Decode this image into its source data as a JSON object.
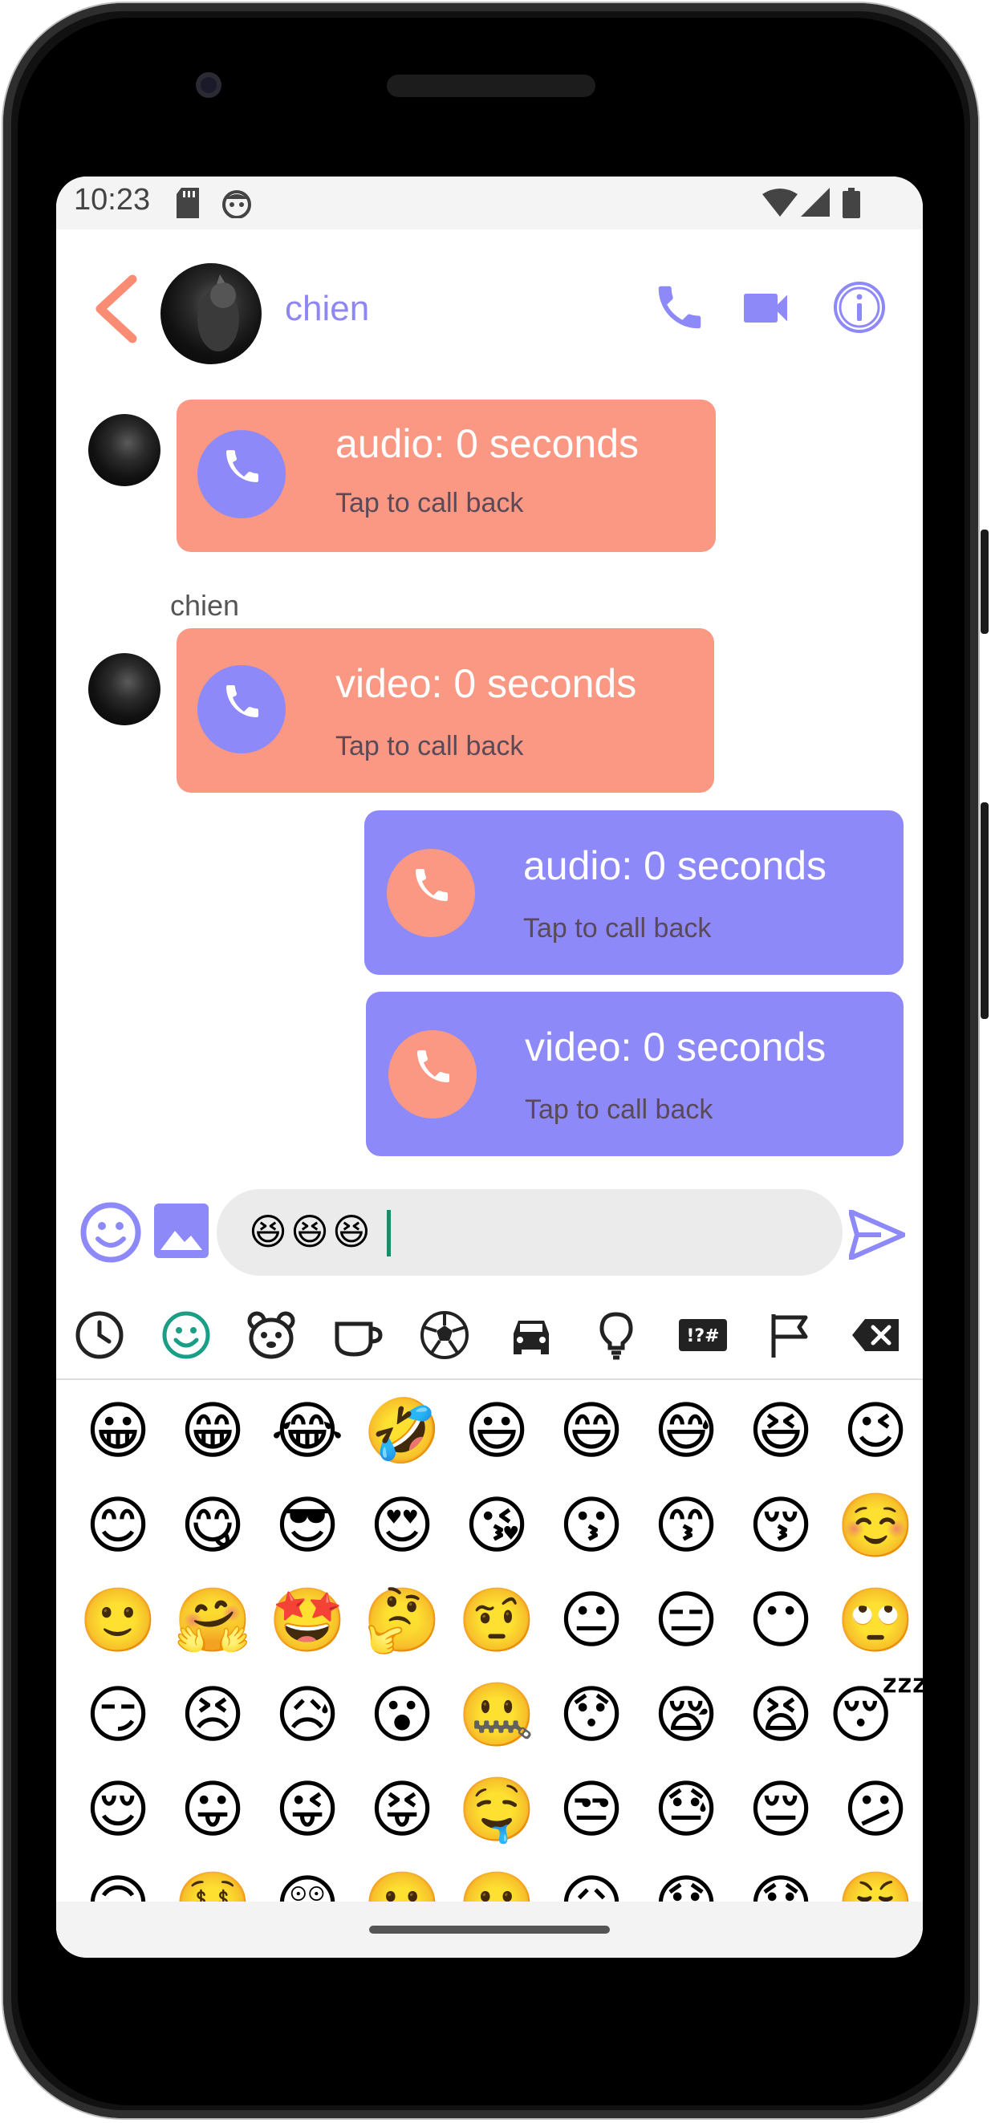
{
  "status_bar": {
    "time": "10:23",
    "icons": [
      "sd-card-icon",
      "android-face-icon",
      "wifi-icon",
      "cell-signal-icon",
      "battery-icon"
    ]
  },
  "header": {
    "contact_name": "chien",
    "icons": [
      "back-arrow-icon",
      "phone-icon",
      "video-camera-icon",
      "info-icon"
    ]
  },
  "messages": [
    {
      "direction": "in",
      "sender": "",
      "title": "audio: 0 seconds",
      "subtitle": "Tap to call back"
    },
    {
      "direction": "in",
      "sender": "chien",
      "title": "video: 0 seconds",
      "subtitle": "Tap to call back"
    },
    {
      "direction": "out",
      "sender": "",
      "title": "audio: 0 seconds",
      "subtitle": "Tap to call back"
    },
    {
      "direction": "out",
      "sender": "",
      "title": "video: 0 seconds",
      "subtitle": "Tap to call back"
    }
  ],
  "composer": {
    "value": "😆😆😆",
    "icons": [
      "emoji-icon",
      "image-icon",
      "send-icon"
    ]
  },
  "keyboard": {
    "categories": [
      {
        "name": "recent",
        "glyph": "🕘"
      },
      {
        "name": "smileys",
        "glyph": "☺"
      },
      {
        "name": "animals",
        "glyph": "🐻"
      },
      {
        "name": "food",
        "glyph": "☕"
      },
      {
        "name": "activities",
        "glyph": "⚽"
      },
      {
        "name": "travel",
        "glyph": "🚗"
      },
      {
        "name": "objects",
        "glyph": "💡"
      },
      {
        "name": "symbols",
        "glyph": "!?#"
      },
      {
        "name": "flags",
        "glyph": "⚐"
      },
      {
        "name": "backspace",
        "glyph": "⌫"
      }
    ],
    "emoji_rows": [
      [
        "😀",
        "😁",
        "😂",
        "🤣",
        "😃",
        "😄",
        "😅",
        "😆",
        "😉"
      ],
      [
        "😊",
        "😋",
        "😎",
        "😍",
        "😘",
        "😗",
        "😙",
        "😚",
        "☺️"
      ],
      [
        "🙂",
        "🤗",
        "🤩",
        "🤔",
        "🤨",
        "😐",
        "😑",
        "😶",
        "🙄"
      ],
      [
        "😏",
        "😣",
        "😥",
        "😮",
        "🤐",
        "😯",
        "😪",
        "😫",
        "😴"
      ],
      [
        "😌",
        "😛",
        "😜",
        "😝",
        "🤤",
        "😒",
        "😓",
        "😔",
        "😕"
      ],
      [
        "🙃",
        "🤑",
        "😲",
        "☹️",
        "🙁",
        "😖",
        "😞",
        "😟",
        "😤"
      ]
    ]
  },
  "colors": {
    "accent_purple": "#8e89f8",
    "accent_salmon": "#fa9883",
    "caret": "#1e8a6a"
  }
}
